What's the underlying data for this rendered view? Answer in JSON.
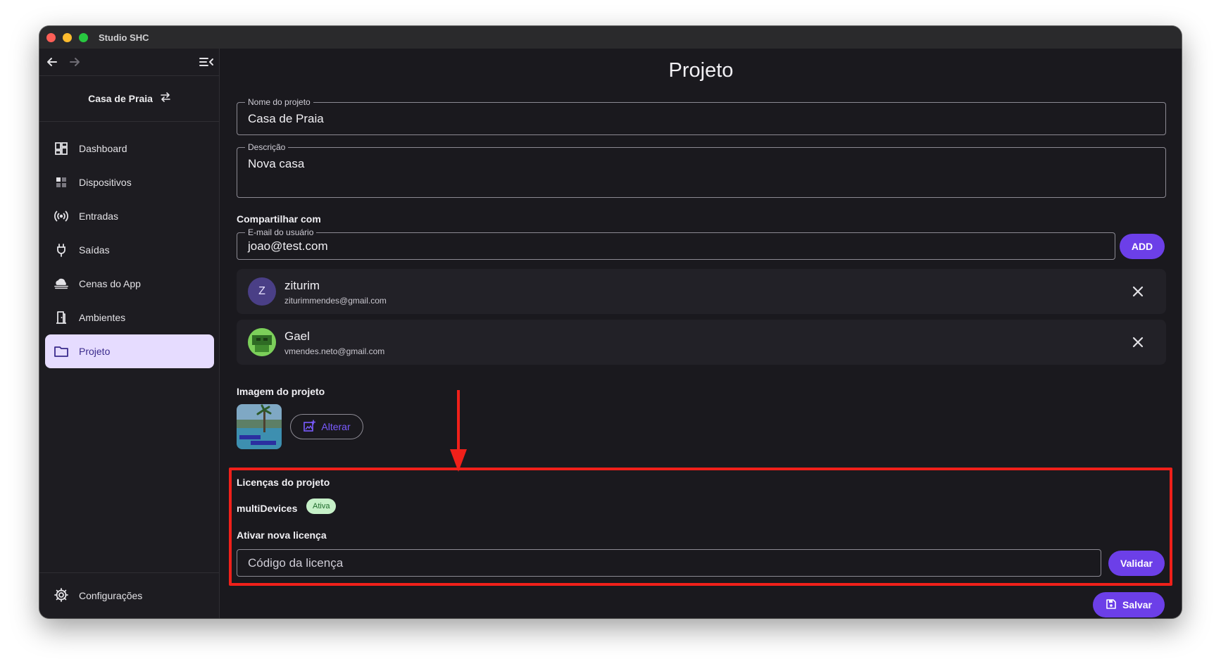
{
  "window": {
    "title": "Studio SHC"
  },
  "sidebar": {
    "project_name": "Casa de Praia",
    "items": [
      {
        "label": "Dashboard",
        "icon": "dashboard-icon",
        "active": false
      },
      {
        "label": "Dispositivos",
        "icon": "devices-icon",
        "active": false
      },
      {
        "label": "Entradas",
        "icon": "sensors-icon",
        "active": false
      },
      {
        "label": "Saídas",
        "icon": "plug-icon",
        "active": false
      },
      {
        "label": "Cenas do App",
        "icon": "cloud-icon",
        "active": false
      },
      {
        "label": "Ambientes",
        "icon": "door-icon",
        "active": false
      },
      {
        "label": "Projeto",
        "icon": "folder-icon",
        "active": true
      }
    ],
    "settings_label": "Configurações"
  },
  "main": {
    "title": "Projeto",
    "project_name_label": "Nome do projeto",
    "project_name_value": "Casa de Praia",
    "description_label": "Descrição",
    "description_value": "Nova casa",
    "share_heading": "Compartilhar com",
    "email_label": "E-mail do usuário",
    "email_value": "joao@test.com",
    "add_label": "ADD",
    "shared_users": [
      {
        "initial": "Z",
        "name": "ziturim",
        "email": "ziturimmendes@gmail.com"
      },
      {
        "initial": "",
        "name": "Gael",
        "email": "vmendes.neto@gmail.com"
      }
    ],
    "image_heading": "Imagem do projeto",
    "change_image_label": "Alterar",
    "licenses_heading": "Licenças do projeto",
    "license_name": "multiDevices",
    "license_status": "Ativa",
    "new_license_heading": "Ativar nova licença",
    "license_input_placeholder": "Código da licença",
    "validate_label": "Validar",
    "save_label": "Salvar"
  },
  "colors": {
    "accent": "#6c3fe8",
    "annotation": "#f0201a",
    "badge_bg": "#c6f0c8",
    "badge_text": "#1e6a2a",
    "delete": "#ff6b6b"
  }
}
